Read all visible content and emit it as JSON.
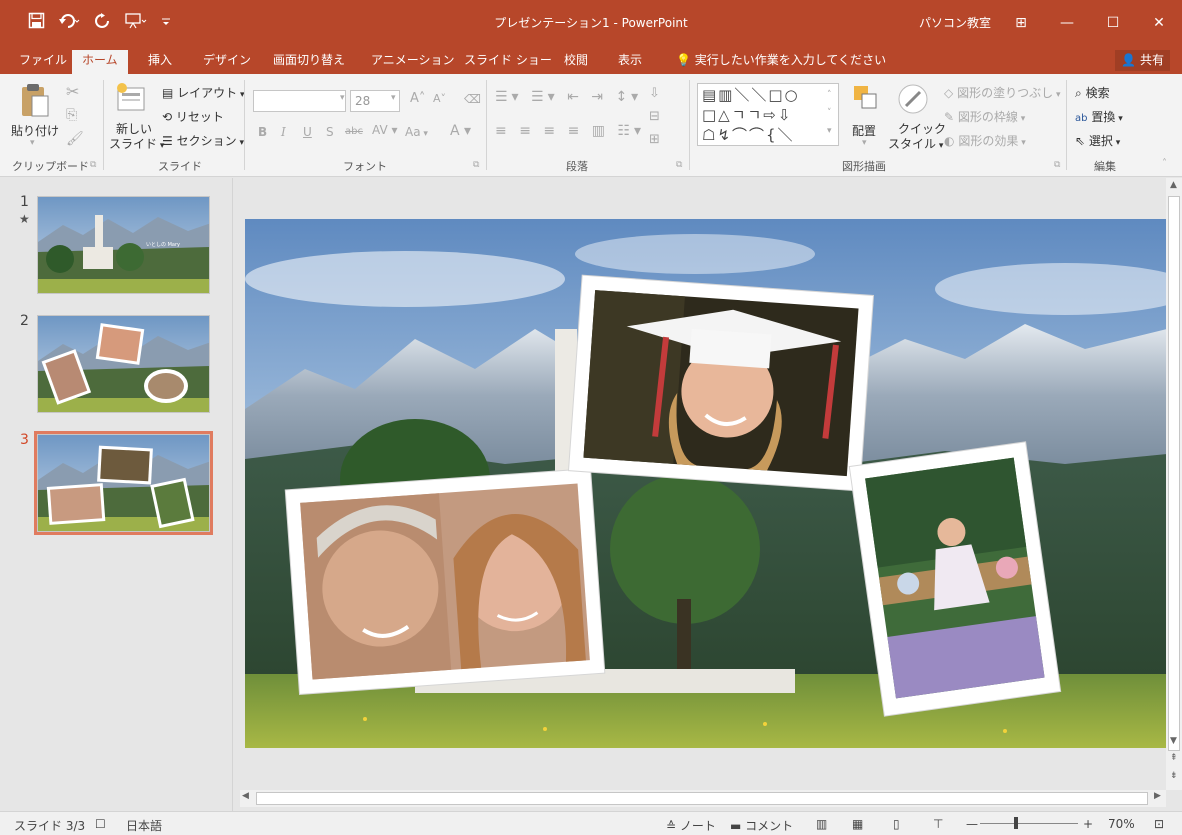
{
  "window": {
    "title": "プレゼンテーション1 - PowerPoint",
    "user": "パソコン教室",
    "controls": [
      "⊞",
      "—",
      "☐",
      "✕"
    ]
  },
  "qat": {
    "save_icon": "save-icon",
    "undo_icon": "undo-icon",
    "redo_icon": "redo-icon",
    "present_icon": "slideshow-from-start-icon",
    "customize_icon": "qat-customize-icon"
  },
  "tabs": {
    "file": "ファイル",
    "home": "ホーム",
    "insert": "挿入",
    "design": "デザイン",
    "transitions": "画面切り替え",
    "animations": "アニメーション",
    "slideshow": "スライド ショー",
    "review": "校閲",
    "view": "表示",
    "tell_me": "実行したい作業を入力してください",
    "share": "共有"
  },
  "ribbon": {
    "clipboard": {
      "paste": "貼り付け",
      "label": "クリップボード"
    },
    "slides": {
      "new_slide": "新しい",
      "new_slide_2": "スライド",
      "layout": "レイアウト",
      "reset": "リセット",
      "section": "セクション",
      "label": "スライド"
    },
    "font": {
      "size": "28",
      "change_case": "Aa",
      "label": "フォント"
    },
    "paragraph": {
      "label": "段落"
    },
    "drawing": {
      "arrange": "配置",
      "quick_styles_1": "クイック",
      "quick_styles_2": "スタイル",
      "shape_fill": "図形の塗りつぶし",
      "shape_outline": "図形の枠線",
      "shape_effects": "図形の効果",
      "label": "図形描画"
    },
    "editing": {
      "find": "検索",
      "replace": "置換",
      "select": "選択",
      "label": "編集"
    }
  },
  "thumbnails": [
    {
      "number": "1",
      "star": "★"
    },
    {
      "number": "2",
      "star": ""
    },
    {
      "number": "3",
      "star": ""
    }
  ],
  "thumb1_caption": "いとしの Mary",
  "status": {
    "slide": "スライド 3/3",
    "language": "日本語",
    "notes": "ノート",
    "comments": "コメント",
    "zoom": "70%"
  },
  "colors": {
    "accent": "#b7472a",
    "ribbon_bg": "#f3f3f3",
    "selected_outline": "#e07b5f"
  }
}
